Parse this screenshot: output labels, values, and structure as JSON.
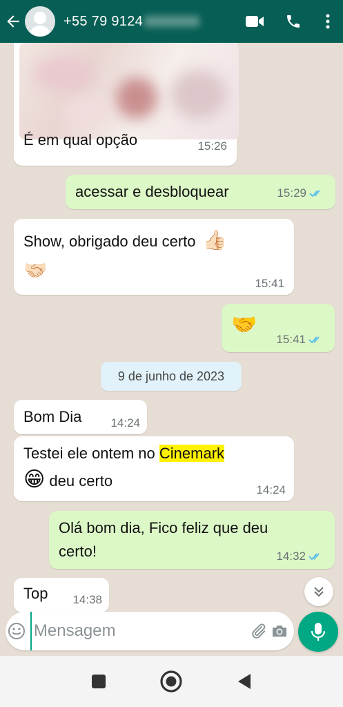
{
  "header": {
    "contact_visible": "+55 79 9124",
    "icons": [
      "back-arrow-icon",
      "video-call-icon",
      "phone-icon",
      "more-vert-icon"
    ],
    "color": "#075e54"
  },
  "messages": [
    {
      "dir": "in",
      "text": "É em qual opção",
      "time": "15:26",
      "has_image": true
    },
    {
      "dir": "out",
      "text": "acessar e desbloquear",
      "time": "15:29",
      "read": true
    },
    {
      "dir": "in",
      "text": "Show, obrigado deu certo",
      "emoji": [
        "👍🏻",
        "🤝🏻"
      ],
      "time": "15:41"
    },
    {
      "dir": "out",
      "emoji": "🤝",
      "time": "15:41",
      "read": true
    },
    {
      "dir": "in",
      "text": "Bom Dia",
      "time": "14:24"
    },
    {
      "dir": "in",
      "text_before": "Testei ele ontem no ",
      "highlight": "Cinemark",
      "emoji": "😁",
      "text_after": " deu certo",
      "time": "14:24"
    },
    {
      "dir": "out",
      "text_line1": "Olá bom dia, Fico feliz que deu",
      "text_line2": "certo!",
      "time": "14:32",
      "read": true
    },
    {
      "dir": "in",
      "text": "Top",
      "time": "14:38"
    }
  ],
  "date_separator": "9 de junho de 2023",
  "input": {
    "placeholder": "Mensagem"
  },
  "colors": {
    "incoming": "#ffffff",
    "outgoing": "#dcf8c6",
    "accent": "#00a884",
    "read_ticks": "#53bdeb",
    "highlight": "#fff200"
  }
}
